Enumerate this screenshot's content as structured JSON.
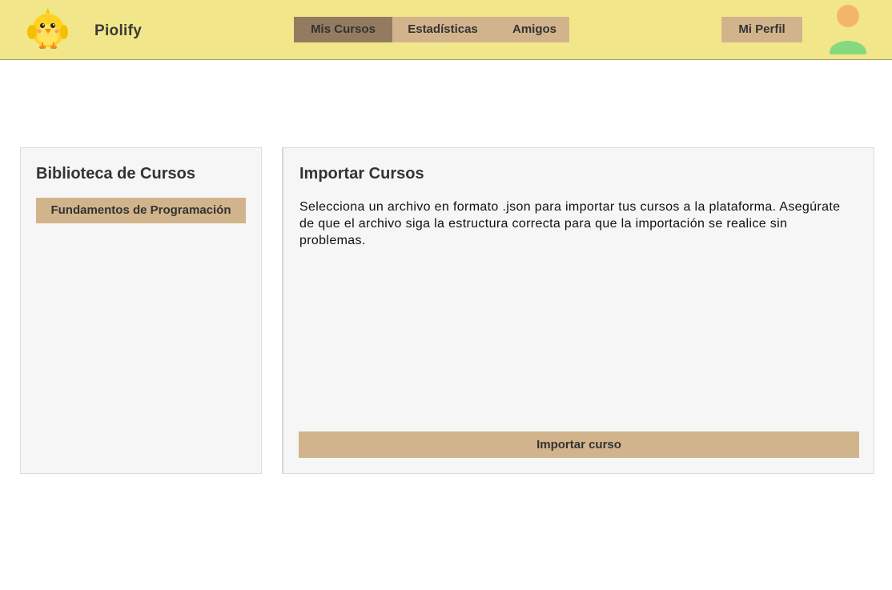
{
  "header": {
    "brand": "Piolify",
    "logo_icon": "chick-mascot-icon",
    "nav": [
      {
        "label": "Mis Cursos",
        "active": true
      },
      {
        "label": "Estadísticas",
        "active": false
      },
      {
        "label": "Amigos",
        "active": false
      }
    ],
    "profile_label": "Mi Perfil",
    "avatar_icon": "user-avatar-icon"
  },
  "library": {
    "title": "Biblioteca de Cursos",
    "courses": [
      "Fundamentos de Programación"
    ]
  },
  "importer": {
    "title": "Importar Cursos",
    "description": "Selecciona un archivo en formato .json para importar tus cursos a la plataforma. Asegúrate de que el archivo siga la estructura correcta para que la importación se realice sin problemas.",
    "button_label": "Importar curso"
  },
  "colors": {
    "header_bg": "#f2e68a",
    "tab_bg": "#d2b48c",
    "tab_active_bg": "#937b60",
    "panel_bg": "#f6f6f6"
  }
}
